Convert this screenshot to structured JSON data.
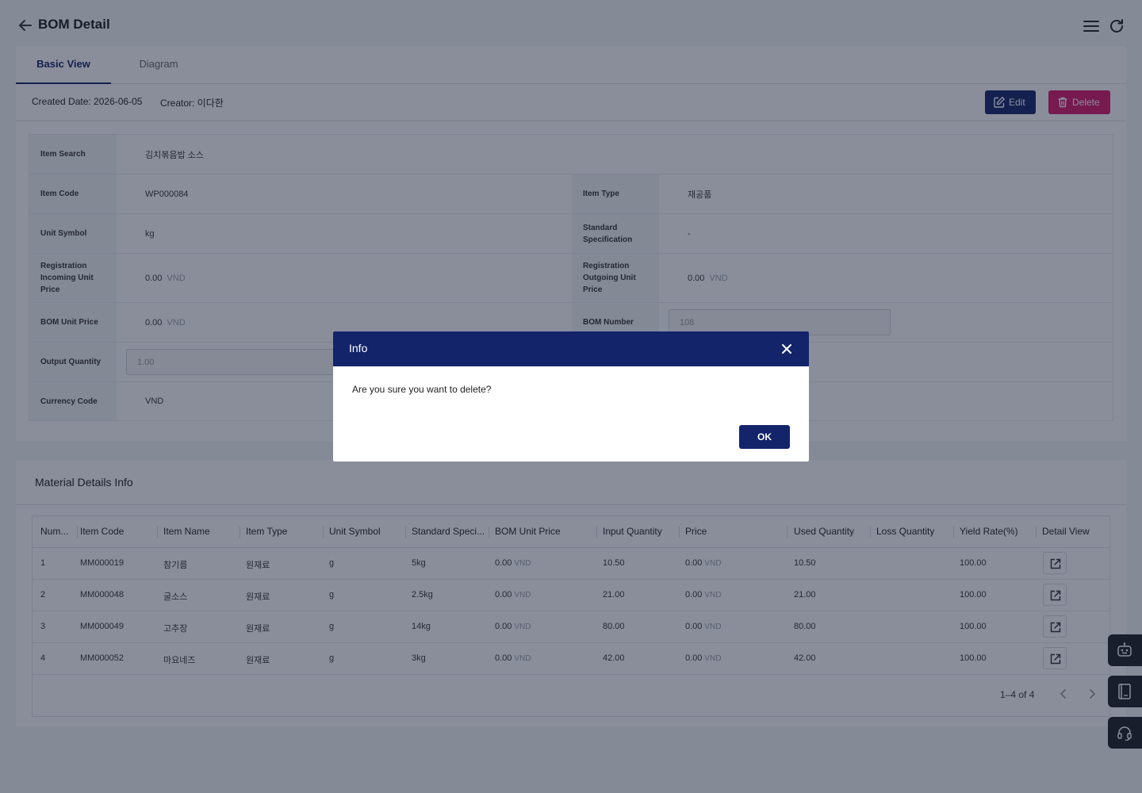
{
  "header": {
    "title": "BOM Detail"
  },
  "tabs": [
    {
      "label": "Basic View"
    },
    {
      "label": "Diagram"
    }
  ],
  "meta": {
    "created": "Created Date: 2026-06-05",
    "creator": "Creator: 이다한"
  },
  "actions": {
    "edit": "Edit",
    "delete": "Delete"
  },
  "form": {
    "item_search": {
      "label": "Item Search",
      "value": "김치볶음밥 소스"
    },
    "item_code": {
      "label": "Item Code",
      "value": "WP000084"
    },
    "item_type": {
      "label": "Item Type",
      "value": "재공품"
    },
    "unit_symbol": {
      "label": "Unit Symbol",
      "value": "kg"
    },
    "standard_spec": {
      "label": "Standard Specification",
      "value": "-"
    },
    "reg_in_price": {
      "label": "Registration Incoming Unit Price",
      "value": "0.00",
      "unit": "VND"
    },
    "reg_out_price": {
      "label": "Registration Outgoing Unit Price",
      "value": "0.00",
      "unit": "VND"
    },
    "bom_unit_price": {
      "label": "BOM Unit Price",
      "value": "0.00",
      "unit": "VND"
    },
    "bom_number": {
      "label": "BOM Number",
      "value": "108"
    },
    "output_quantity": {
      "label": "Output Quantity",
      "value": "1.00"
    },
    "currency_code": {
      "label": "Currency Code",
      "value": "VND"
    }
  },
  "materials": {
    "title": "Material Details Info",
    "columns": [
      "Num...",
      "Item Code",
      "Item Name",
      "Item Type",
      "Unit Symbol",
      "Standard Speci...",
      "BOM Unit Price",
      "Input Quantity",
      "Price",
      "Used Quantity",
      "Loss Quantity",
      "Yield Rate(%)",
      "Detail View"
    ],
    "currency": "VND",
    "rows": [
      {
        "num": "1",
        "code": "MM000019",
        "name": "참기름",
        "type": "원재료",
        "unit": "g",
        "spec": "5kg",
        "bom_price": "0.00",
        "input_qty": "10.50",
        "price": "0.00",
        "used_qty": "10.50",
        "loss_qty": "",
        "yield": "100.00"
      },
      {
        "num": "2",
        "code": "MM000048",
        "name": "굴소스",
        "type": "원재료",
        "unit": "g",
        "spec": "2.5kg",
        "bom_price": "0.00",
        "input_qty": "21.00",
        "price": "0.00",
        "used_qty": "21.00",
        "loss_qty": "",
        "yield": "100.00"
      },
      {
        "num": "3",
        "code": "MM000049",
        "name": "고추장",
        "type": "원재료",
        "unit": "g",
        "spec": "14kg",
        "bom_price": "0.00",
        "input_qty": "80.00",
        "price": "0.00",
        "used_qty": "80.00",
        "loss_qty": "",
        "yield": "100.00"
      },
      {
        "num": "4",
        "code": "MM000052",
        "name": "마요네즈",
        "type": "원재료",
        "unit": "g",
        "spec": "3kg",
        "bom_price": "0.00",
        "input_qty": "42.00",
        "price": "0.00",
        "used_qty": "42.00",
        "loss_qty": "",
        "yield": "100.00"
      }
    ],
    "pagination": "1–4 of 4"
  },
  "floating": {
    "icons": [
      "robot-icon",
      "manual-icon",
      "headset-icon"
    ]
  },
  "modal": {
    "title": "Info",
    "message": "Are you sure you want to delete?",
    "ok": "OK"
  },
  "colors": {
    "primary": "#13246b",
    "danger": "#d6166b",
    "overlay": "rgba(22,30,54,0.5)"
  }
}
